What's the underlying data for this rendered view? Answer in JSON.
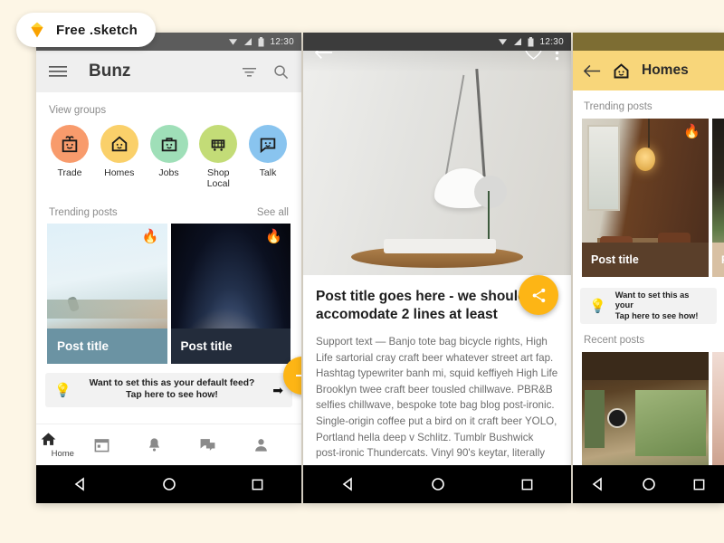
{
  "badge": {
    "label": "Free .sketch",
    "icon": "sketch-diamond-icon"
  },
  "background_color": "#fdf6e6",
  "accent_color": "#fdb515",
  "phone1": {
    "statusbar": {
      "time": "12:30",
      "icons": [
        "wifi-icon",
        "signal-icon",
        "battery-icon"
      ]
    },
    "toolbar": {
      "menu_icon": "hamburger-menu-icon",
      "title": "Bunz",
      "filter_icon": "filter-icon",
      "search_icon": "search-icon"
    },
    "groups_header": "View groups",
    "groups": [
      {
        "label": "Trade",
        "color": "#f89b6c",
        "icon": "gift-box-face-icon"
      },
      {
        "label": "Homes",
        "color": "#fad06a",
        "icon": "house-face-icon"
      },
      {
        "label": "Jobs",
        "color": "#9fdfb8",
        "icon": "briefcase-face-icon"
      },
      {
        "label": "Shop Local",
        "color": "#c3dc77",
        "icon": "shopping-cart-face-icon"
      },
      {
        "label": "Talk",
        "color": "#89c4ef",
        "icon": "speech-laptop-face-icon"
      }
    ],
    "trending": {
      "label": "Trending posts",
      "see_all": "See all"
    },
    "cards": [
      {
        "title": "Post title",
        "badge": "🔥",
        "caption_bg": "#6b93a3"
      },
      {
        "title": "Post title",
        "badge": "🔥",
        "caption_bg": "#232c3b"
      }
    ],
    "tip": {
      "icon": "lightbulb-icon",
      "line1": "Want to set this as your default feed?",
      "line2": "Tap here to see how!",
      "arrow": "➡"
    },
    "fab": {
      "icon": "plus-icon",
      "label": "+"
    },
    "bottom_nav": [
      {
        "name": "home",
        "icon": "home-icon",
        "label": "Home",
        "active": true
      },
      {
        "name": "calendar",
        "icon": "calendar-icon",
        "label": ""
      },
      {
        "name": "notifications",
        "icon": "bell-icon",
        "label": ""
      },
      {
        "name": "messages",
        "icon": "chat-icon",
        "label": ""
      },
      {
        "name": "profile",
        "icon": "person-icon",
        "label": ""
      }
    ]
  },
  "phone2": {
    "statusbar": {
      "time": "12:30"
    },
    "toolbar": {
      "back_icon": "back-arrow-icon",
      "favorite_icon": "heart-outline-icon",
      "more_icon": "overflow-menu-icon"
    },
    "fab": {
      "icon": "share-icon"
    },
    "title": "Post title goes here - we should accomodate 2 lines at least",
    "body": "Support text — Banjo tote bag bicycle rights, High Life sartorial cray craft beer whatever street art fap. Hashtag typewriter banh mi, squid keffiyeh High Life Brooklyn twee craft beer tousled chillwave. PBR&B selfies chillwave, bespoke tote bag blog post-ironic. Single-origin coffee put a bird on it craft beer YOLO, Portland hella deep v Schlitz. Tumblr Bushwick post-ironic Thundercats. Vinyl 90's keytar, literally"
  },
  "phone3": {
    "statusbar": {
      "time": ""
    },
    "toolbar": {
      "back_icon": "back-arrow-icon",
      "icon": "house-face-icon",
      "title": "Homes",
      "bg": "#f8d67a"
    },
    "trending_label": "Trending posts",
    "cards": [
      {
        "title": "Post title",
        "badge": "🔥",
        "caption_bg": "#5a3f2a"
      },
      {
        "title": "P",
        "badge": "",
        "caption_bg": "#d8c0a3"
      }
    ],
    "tip": {
      "icon": "lightbulb-icon",
      "line1": "Want to set this as your",
      "line2": "Tap here to see how!"
    },
    "recent_label": "Recent posts"
  },
  "system_nav": {
    "back": "back-triangle-icon",
    "home": "home-circle-icon",
    "recents": "recents-square-icon"
  }
}
